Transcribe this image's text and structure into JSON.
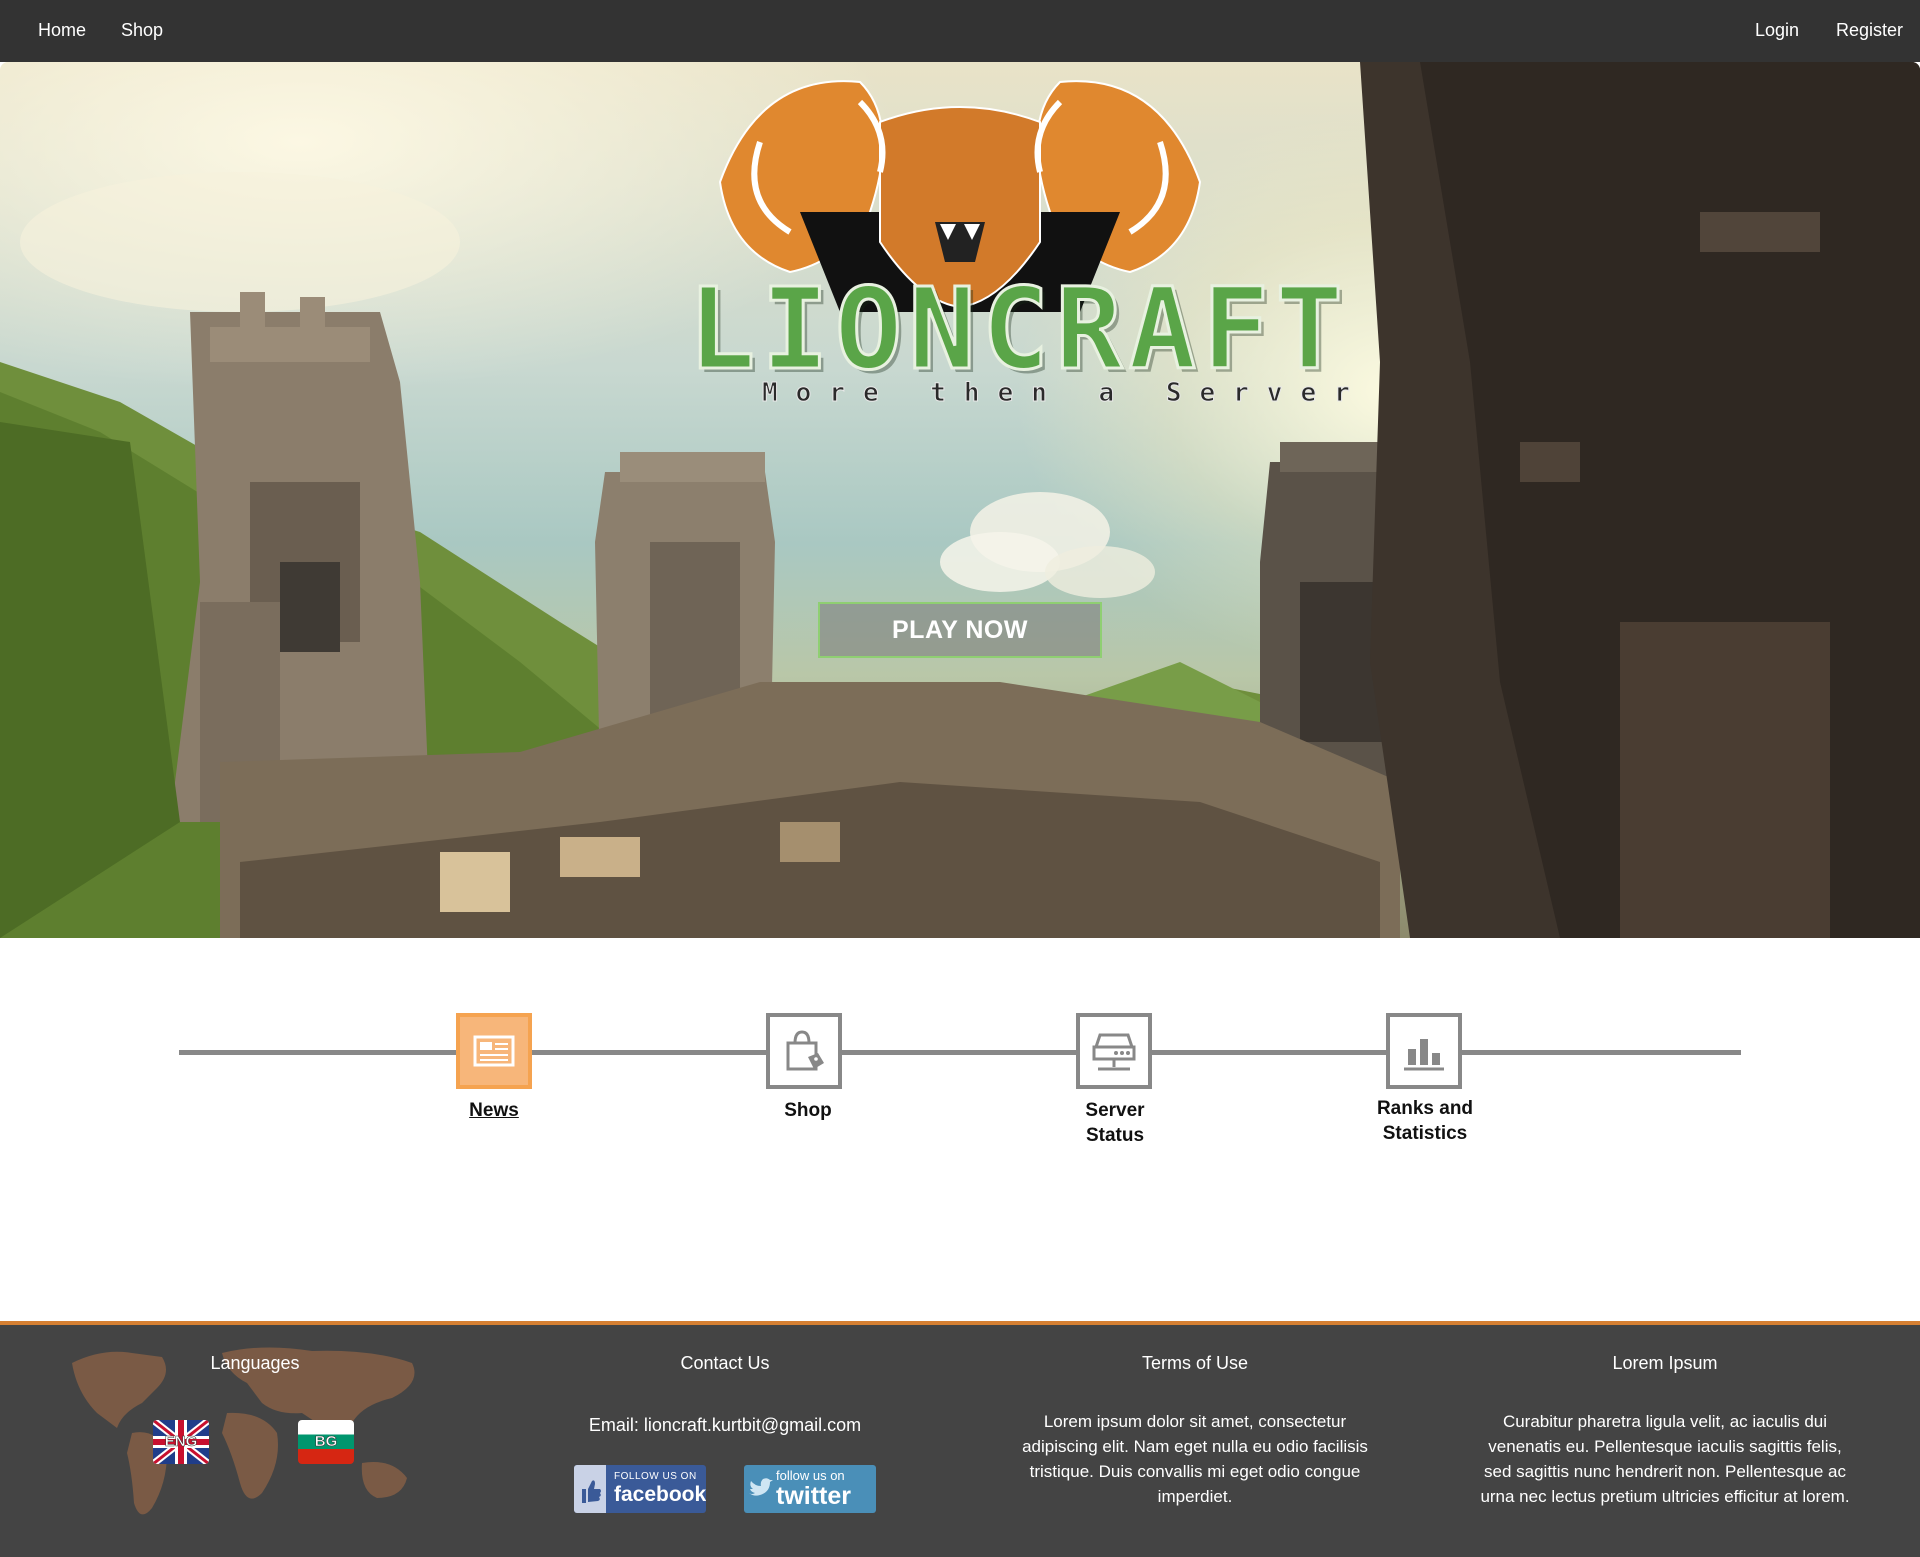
{
  "nav": {
    "home": "Home",
    "shop": "Shop",
    "login": "Login",
    "register": "Register"
  },
  "hero": {
    "logo_text": "LIONCRAFT",
    "tagline": "More then a Server",
    "play_button": "PLAY NOW"
  },
  "features": [
    {
      "label": "News",
      "icon": "newspaper-icon",
      "active": true
    },
    {
      "label": "Shop",
      "icon": "shopping-bag-icon",
      "active": false
    },
    {
      "label": "Server Status",
      "icon": "server-icon",
      "active": false
    },
    {
      "label": "Ranks and Statistics",
      "icon": "bar-chart-icon",
      "active": false
    }
  ],
  "footer": {
    "languages": {
      "title": "Languages",
      "flags": [
        "ENG",
        "BG"
      ]
    },
    "contact": {
      "title": "Contact Us",
      "email": "Email: lioncraft.kurtbit@gmail.com",
      "facebook_small": "FOLLOW US ON",
      "facebook_big": "facebook",
      "twitter_small": "follow us on",
      "twitter_big": "twitter"
    },
    "terms": {
      "title": "Terms of Use",
      "text": "Lorem ipsum dolor sit amet, consectetur adipiscing elit. Nam eget nulla eu odio facilisis tristique. Duis convallis mi eget odio congue imperdiet."
    },
    "lorem": {
      "title": "Lorem Ipsum",
      "text": "Curabitur pharetra ligula velit, ac iaculis dui venenatis eu. Pellentesque iaculis sagittis felis, sed sagittis nunc hendrerit non. Pellentesque ac urna nec lectus pretium ultricies efficitur at lorem."
    }
  },
  "colors": {
    "nav_bg": "#333333",
    "accent_orange": "#f5a350",
    "footer_bg": "#444444",
    "footer_border": "#d58033",
    "logo_green": "#5aa548"
  }
}
